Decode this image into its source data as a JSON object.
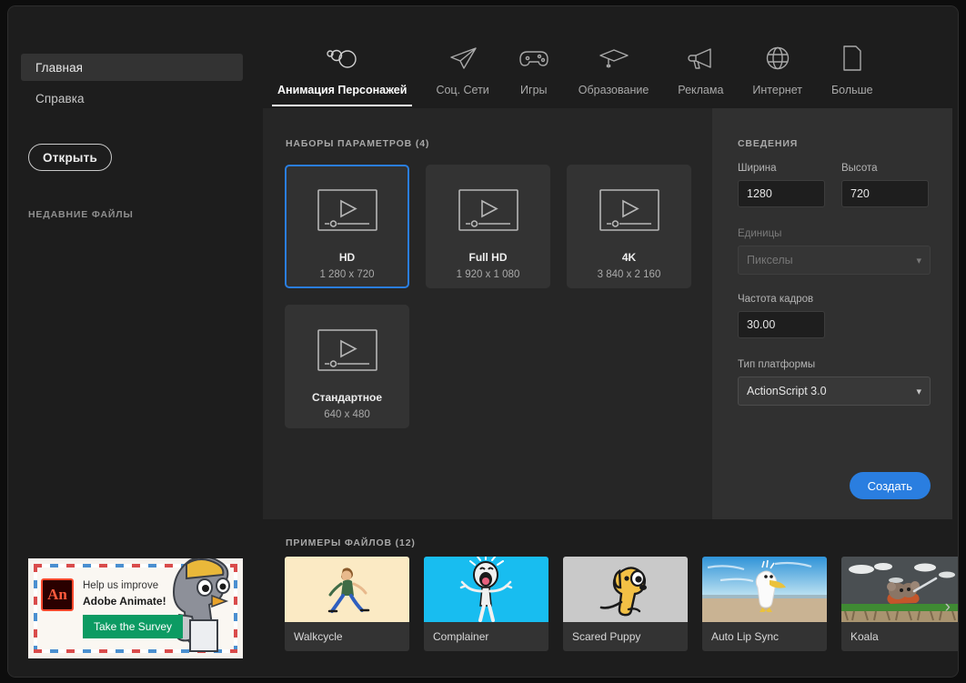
{
  "sidebar": {
    "nav": [
      {
        "label": "Главная",
        "name": "sidebar-item-home",
        "active": true
      },
      {
        "label": "Справка",
        "name": "sidebar-item-help",
        "active": false
      }
    ],
    "open_button": "Открыть",
    "recent_files_title": "НЕДАВНИЕ ФАЙЛЫ"
  },
  "promo": {
    "logo_text": "An",
    "line1": "Help us improve",
    "line2": "Adobe Animate!",
    "button": "Take the Survey",
    "button_color": "#0c9b63",
    "logo_color": "#ff4a2e"
  },
  "tabs": [
    {
      "label": "Анимация Персонажей",
      "icon": "character-animation-icon",
      "active": true
    },
    {
      "label": "Соц. Сети",
      "icon": "paper-plane-icon",
      "active": false
    },
    {
      "label": "Игры",
      "icon": "gamepad-icon",
      "active": false
    },
    {
      "label": "Образование",
      "icon": "graduation-cap-icon",
      "active": false
    },
    {
      "label": "Реклама",
      "icon": "megaphone-icon",
      "active": false
    },
    {
      "label": "Интернет",
      "icon": "globe-icon",
      "active": false
    },
    {
      "label": "Больше",
      "icon": "document-icon",
      "active": false
    }
  ],
  "presets": {
    "title": "НАБОРЫ ПАРАМЕТРОВ (4)",
    "items": [
      {
        "name": "HD",
        "dims": "1 280 x 720",
        "selected": true
      },
      {
        "name": "Full HD",
        "dims": "1 920 x 1 080",
        "selected": false
      },
      {
        "name": "4K",
        "dims": "3 840 x 2 160",
        "selected": false
      },
      {
        "name": "Стандартное",
        "dims": "640 x 480",
        "selected": false
      }
    ]
  },
  "details": {
    "title": "СВЕДЕНИЯ",
    "width": {
      "label": "Ширина",
      "value": "1280"
    },
    "height": {
      "label": "Высота",
      "value": "720"
    },
    "units": {
      "label": "Единицы",
      "value": "Пикселы",
      "disabled": true
    },
    "framerate": {
      "label": "Частота кадров",
      "value": "30.00"
    },
    "platform": {
      "label": "Тип платформы",
      "value": "ActionScript 3.0"
    },
    "create_button": "Создать",
    "accent_color": "#2a7ee0"
  },
  "samples": {
    "title": "ПРИМЕРЫ ФАЙЛОВ (12)",
    "next_icon": "chevron-right-icon",
    "items": [
      {
        "name": "Walkcycle",
        "thumb": "walkcycle"
      },
      {
        "name": "Complainer",
        "thumb": "complainer"
      },
      {
        "name": "Scared Puppy",
        "thumb": "scared-puppy"
      },
      {
        "name": "Auto Lip Sync",
        "thumb": "auto-lip-sync"
      },
      {
        "name": "Koala",
        "thumb": "koala"
      }
    ]
  }
}
